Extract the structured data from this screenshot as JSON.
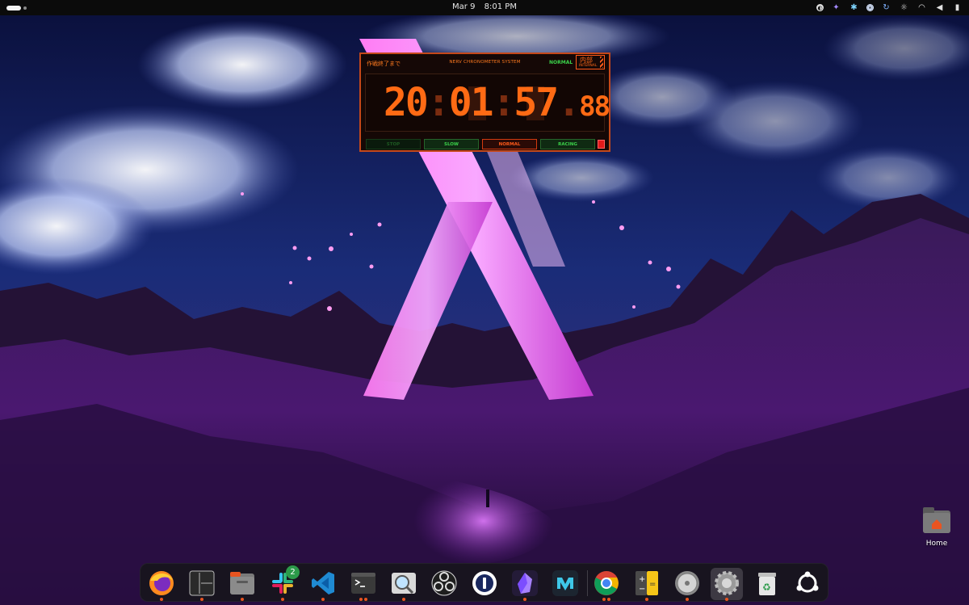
{
  "topbar": {
    "date": "Mar 9",
    "time": "8:01 PM"
  },
  "tray_icons": [
    "brightness-icon",
    "extension-icon",
    "slack-tray-icon",
    "vpn-icon",
    "refresh-icon",
    "settings-sun-icon",
    "wifi-icon",
    "volume-icon",
    "battery-icon"
  ],
  "widget": {
    "jp_label": "作戦終了まで",
    "system_name": "NERV CHRONOMETER SYSTEM",
    "mode_label": "NORMAL",
    "badge_kanji": "内部",
    "badge_en": "INTERNAL",
    "time_hh": "20",
    "time_mm": "01",
    "time_ss": "57",
    "time_frac": "88",
    "sep": ":",
    "dot": ".",
    "buttons": {
      "stop": "STOP",
      "slow": "SLOW",
      "normal": "NORMAL",
      "racing": "RACING"
    },
    "colors": {
      "accent": "#ff6a14",
      "ok": "#3bd24a",
      "alert": "#e11a1a"
    }
  },
  "desktop": {
    "home_label": "Home"
  },
  "dock": {
    "apps": [
      {
        "name": "Firefox",
        "icon": "firefox-icon"
      },
      {
        "name": "Screen layout",
        "icon": "window-layout-icon"
      },
      {
        "name": "Files",
        "icon": "files-icon"
      },
      {
        "name": "Slack",
        "icon": "slack-icon",
        "badge": "2"
      },
      {
        "name": "Visual Studio Code",
        "icon": "vscode-icon"
      },
      {
        "name": "Terminal",
        "icon": "terminal-icon"
      },
      {
        "name": "Image Viewer",
        "icon": "image-viewer-icon"
      },
      {
        "name": "OBS Studio",
        "icon": "obs-icon"
      },
      {
        "name": "1Password",
        "icon": "onepassword-icon"
      },
      {
        "name": "Obsidian",
        "icon": "obsidian-icon"
      },
      {
        "name": "Mailspring",
        "icon": "mailspring-icon"
      },
      {
        "name": "Google Chrome",
        "icon": "chrome-icon"
      },
      {
        "name": "Calculator",
        "icon": "calculator-icon"
      },
      {
        "name": "Disk Utility",
        "icon": "disk-icon"
      },
      {
        "name": "Settings",
        "icon": "settings-icon"
      },
      {
        "name": "Trash",
        "icon": "trash-icon"
      },
      {
        "name": "Show Applications",
        "icon": "ubuntu-icon"
      }
    ]
  }
}
